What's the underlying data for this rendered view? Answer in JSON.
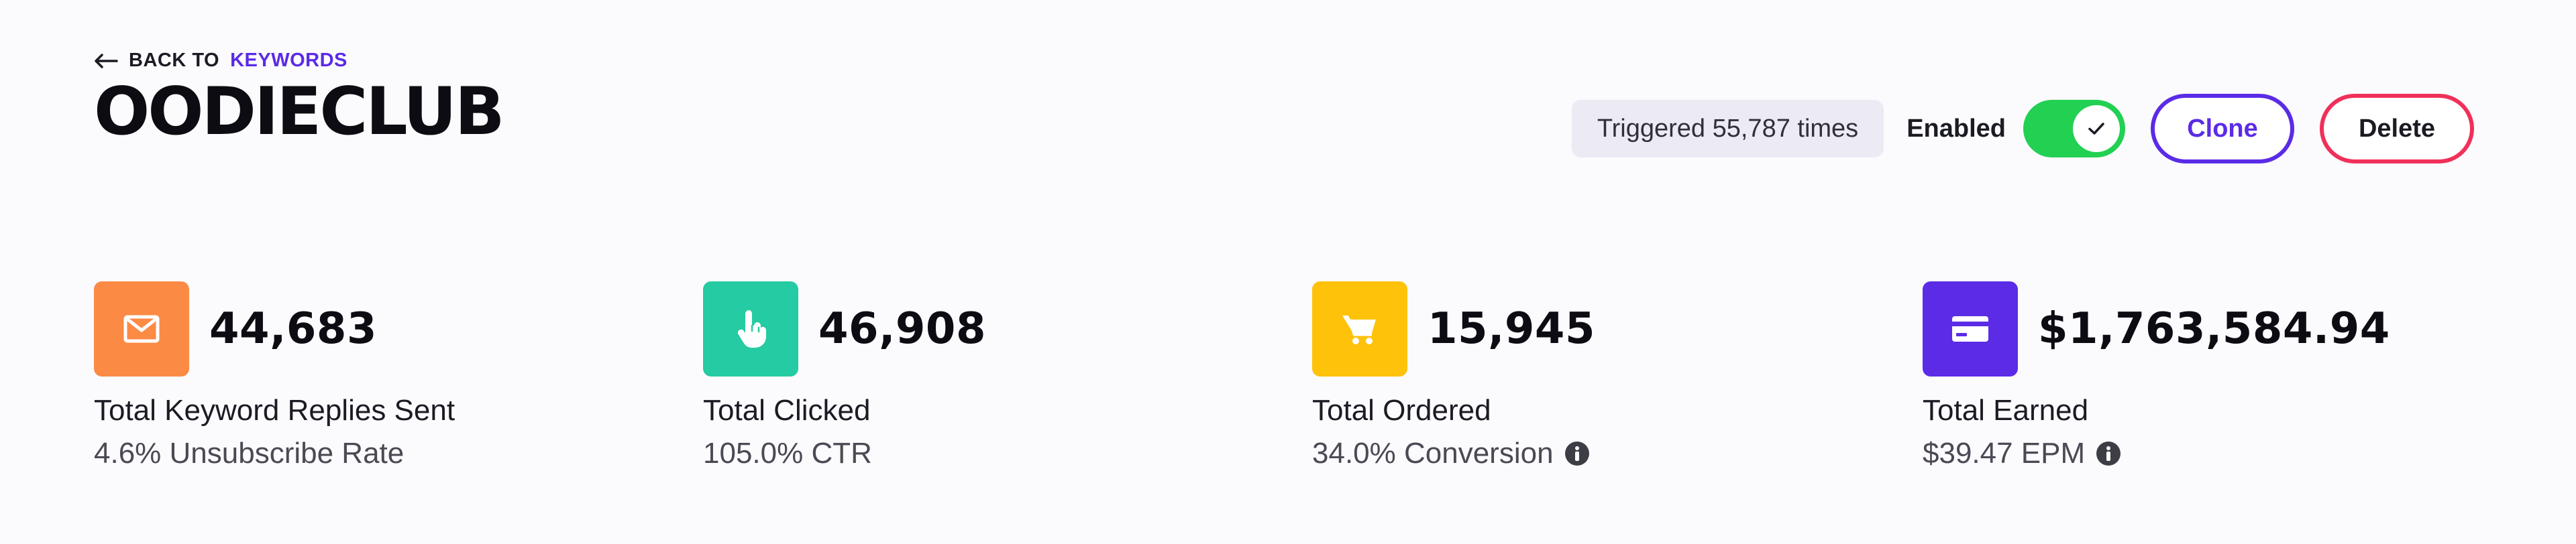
{
  "nav": {
    "back_prefix": "BACK TO",
    "back_keyword": "KEYWORDS",
    "back_icon": "arrow-left-icon"
  },
  "page": {
    "title": "OODIECLUB"
  },
  "header": {
    "triggered": "Triggered 55,787 times",
    "enabled_label": "Enabled",
    "enabled": true,
    "clone_label": "Clone",
    "delete_label": "Delete"
  },
  "colors": {
    "accent": "#5b2be6",
    "toggle_on": "#22d052",
    "delete_border": "#f0305a",
    "background": "#fbfafd"
  },
  "stats": [
    {
      "icon": "mail-icon",
      "color": "#fb8a44",
      "value": "44,683",
      "label": "Total Keyword Replies Sent",
      "sub": "4.6% Unsubscribe Rate",
      "has_info": false
    },
    {
      "icon": "pointer-hand-icon",
      "color": "#25cba2",
      "value": "46,908",
      "label": "Total Clicked",
      "sub": "105.0% CTR",
      "has_info": false
    },
    {
      "icon": "cart-icon",
      "color": "#ffc20a",
      "value": "15,945",
      "label": "Total Ordered",
      "sub": "34.0% Conversion",
      "has_info": true
    },
    {
      "icon": "credit-card-icon",
      "color": "#5b2be6",
      "value": "$1,763,584.94",
      "label": "Total Earned",
      "sub": "$39.47 EPM",
      "has_info": true
    }
  ]
}
